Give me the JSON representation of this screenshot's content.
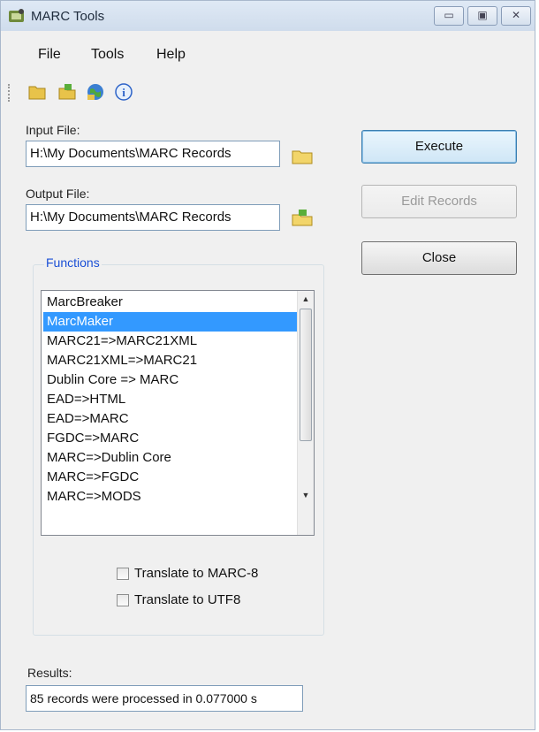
{
  "window": {
    "title": "MARC Tools",
    "controls": {
      "minimize": "▭",
      "maximize": "▣",
      "close": "✕"
    }
  },
  "menu": [
    "File",
    "Tools",
    "Help"
  ],
  "toolbar": {
    "icons": [
      "open-folder-icon",
      "save-folder-icon",
      "globe-icon",
      "info-icon"
    ],
    "info_glyph": "i"
  },
  "input": {
    "label": "Input File:",
    "value": "H:\\My Documents\\MARC Records"
  },
  "output": {
    "label": "Output File:",
    "value": "H:\\My Documents\\MARC Records"
  },
  "buttons": {
    "execute": "Execute",
    "edit": "Edit Records",
    "close": "Close"
  },
  "functions": {
    "title": "Functions",
    "items": [
      "MarcBreaker",
      "MarcMaker",
      "MARC21=>MARC21XML",
      "MARC21XML=>MARC21",
      "Dublin Core => MARC",
      "EAD=>HTML",
      "EAD=>MARC",
      "FGDC=>MARC",
      "MARC=>Dublin Core",
      "MARC=>FGDC",
      "MARC=>MODS"
    ],
    "selected_index": 1,
    "options": [
      "Translate to MARC-8",
      "Translate to UTF8"
    ]
  },
  "results": {
    "label": "Results:",
    "value": "85 records were processed in 0.077000 s"
  },
  "colors": {
    "accent": "#1a4fd6",
    "selection": "#3399ff",
    "folder": "#e8c34a"
  }
}
